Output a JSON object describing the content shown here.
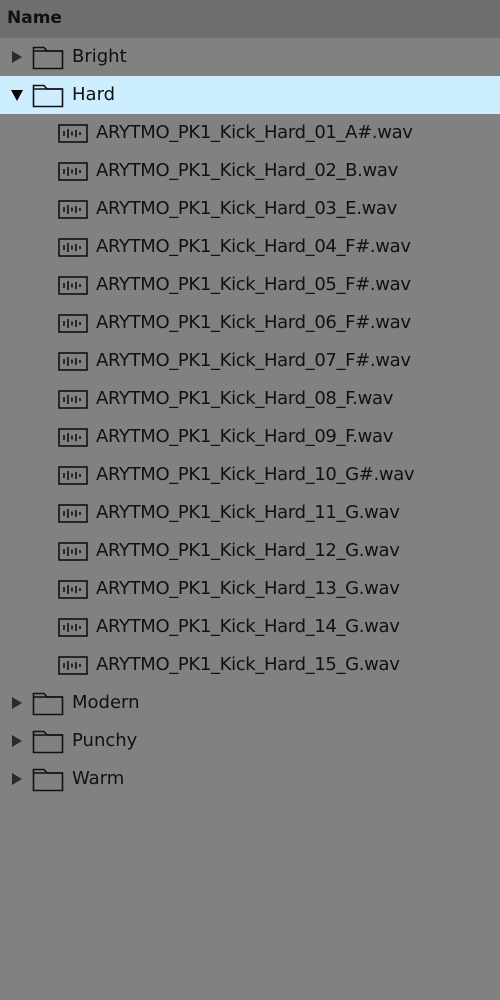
{
  "header": {
    "name_label": "Name"
  },
  "tree": {
    "folders_before": [
      {
        "label": "Bright",
        "expanded": false
      }
    ],
    "expanded_folder": {
      "label": "Hard",
      "expanded": true,
      "files": [
        "ARYTMO_PK1_Kick_Hard_01_A#.wav",
        "ARYTMO_PK1_Kick_Hard_02_B.wav",
        "ARYTMO_PK1_Kick_Hard_03_E.wav",
        "ARYTMO_PK1_Kick_Hard_04_F#.wav",
        "ARYTMO_PK1_Kick_Hard_05_F#.wav",
        "ARYTMO_PK1_Kick_Hard_06_F#.wav",
        "ARYTMO_PK1_Kick_Hard_07_F#.wav",
        "ARYTMO_PK1_Kick_Hard_08_F.wav",
        "ARYTMO_PK1_Kick_Hard_09_F.wav",
        "ARYTMO_PK1_Kick_Hard_10_G#.wav",
        "ARYTMO_PK1_Kick_Hard_11_G.wav",
        "ARYTMO_PK1_Kick_Hard_12_G.wav",
        "ARYTMO_PK1_Kick_Hard_13_G.wav",
        "ARYTMO_PK1_Kick_Hard_14_G.wav",
        "ARYTMO_PK1_Kick_Hard_15_G.wav"
      ]
    },
    "folders_after": [
      {
        "label": "Modern",
        "expanded": false
      },
      {
        "label": "Punchy",
        "expanded": false
      },
      {
        "label": "Warm",
        "expanded": false
      }
    ]
  },
  "colors": {
    "background": "#818181",
    "header_background": "#6e6e6e",
    "selected_row": "#cdeeff",
    "text": "#111111"
  },
  "icons": {
    "collapsed_toggle": "triangle-right-icon",
    "expanded_toggle": "triangle-down-icon",
    "folder": "folder-icon",
    "audio_file": "audio-waveform-icon"
  }
}
